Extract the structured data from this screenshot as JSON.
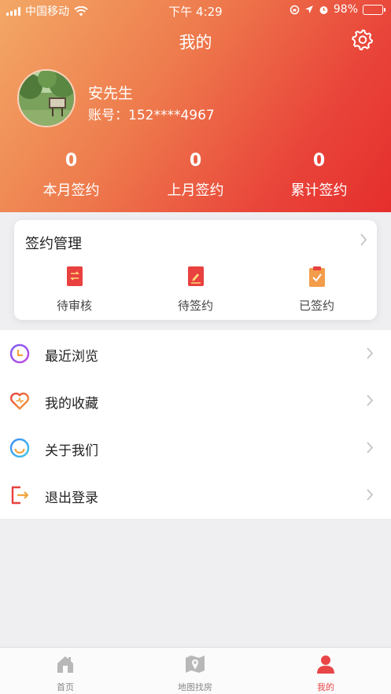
{
  "status_bar": {
    "carrier": "中国移动",
    "time": "下午 4:29",
    "battery": "98%"
  },
  "header": {
    "title": "我的",
    "settings_icon": "gear-icon"
  },
  "profile": {
    "name": "安先生",
    "account": "账号：152****4967"
  },
  "stats": [
    {
      "value": "0",
      "label": "本月签约"
    },
    {
      "value": "0",
      "label": "上月签约"
    },
    {
      "value": "0",
      "label": "累计签约"
    }
  ],
  "contract_card": {
    "title": "签约管理",
    "items": [
      {
        "label": "待审核",
        "icon": "pending-review-icon",
        "color": "#e8413f"
      },
      {
        "label": "待签约",
        "icon": "pending-sign-icon",
        "color": "#e8413f"
      },
      {
        "label": "已签约",
        "icon": "signed-clipboard-icon",
        "color": "#f39c4a"
      }
    ]
  },
  "menu": [
    {
      "label": "最近浏览",
      "icon": "clock-icon"
    },
    {
      "label": "我的收藏",
      "icon": "heart-icon"
    },
    {
      "label": "关于我们",
      "icon": "smile-icon"
    },
    {
      "label": "退出登录",
      "icon": "logout-icon"
    }
  ],
  "tabbar": [
    {
      "label": "首页",
      "icon": "home-icon",
      "active": false
    },
    {
      "label": "地图找房",
      "icon": "map-icon",
      "active": false
    },
    {
      "label": "我的",
      "icon": "user-icon",
      "active": true
    }
  ],
  "colors": {
    "accent": "#e84547",
    "gradient_start": "#f3a866",
    "gradient_end": "#e52e2c"
  }
}
